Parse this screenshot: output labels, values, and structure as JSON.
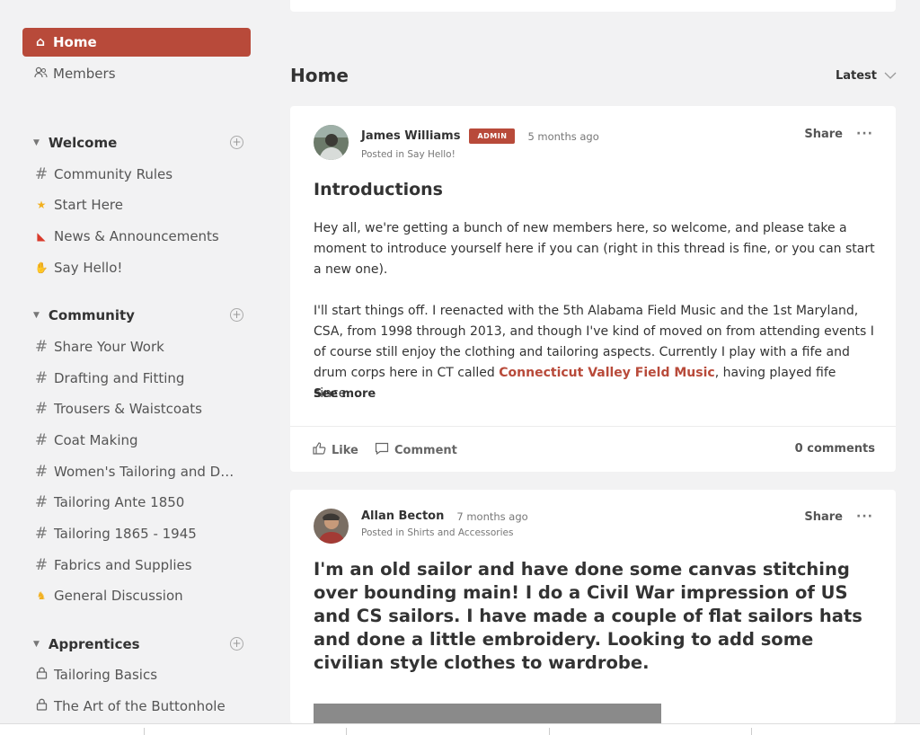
{
  "sidebar": {
    "nav": [
      {
        "label": "Home",
        "icon": "home-icon"
      },
      {
        "label": "Members",
        "icon": "members-icon"
      }
    ],
    "sections": [
      {
        "title": "Welcome",
        "channels": [
          {
            "label": "Community Rules",
            "icon": "hash-icon"
          },
          {
            "label": "Start Here",
            "icon": "star-icon"
          },
          {
            "label": "News & Announcements",
            "icon": "megaphone-icon"
          },
          {
            "label": "Say Hello!",
            "icon": "wave-icon"
          }
        ]
      },
      {
        "title": "Community",
        "channels": [
          {
            "label": "Share Your Work",
            "icon": "hash-icon"
          },
          {
            "label": "Drafting and Fitting",
            "icon": "hash-icon"
          },
          {
            "label": "Trousers & Waistcoats",
            "icon": "hash-icon"
          },
          {
            "label": "Coat Making",
            "icon": "hash-icon"
          },
          {
            "label": "Women's Tailoring and D…",
            "icon": "hash-icon"
          },
          {
            "label": "Tailoring Ante 1850",
            "icon": "hash-icon"
          },
          {
            "label": "Tailoring 1865 - 1945",
            "icon": "hash-icon"
          },
          {
            "label": "Fabrics and Supplies",
            "icon": "hash-icon"
          },
          {
            "label": "General Discussion",
            "icon": "cat-icon"
          }
        ]
      },
      {
        "title": "Apprentices",
        "channels": [
          {
            "label": "Tailoring Basics",
            "icon": "lock-icon"
          },
          {
            "label": "The Art of the Buttonhole",
            "icon": "lock-icon"
          }
        ]
      }
    ]
  },
  "main": {
    "title": "Home",
    "sort_label": "Latest",
    "posts": [
      {
        "author": "James Williams",
        "badge": "ADMIN",
        "time": "5 months ago",
        "posted_in": "Posted in Say Hello!",
        "share": "Share",
        "more": "···",
        "title": "Introductions",
        "para1": "Hey all, we're getting a bunch of new members here, so welcome, and please take a moment to introduce yourself here if you can (right in this thread is fine, or you can start a new one).",
        "para2_a": "I'll start things off. I reenacted with the 5th Alabama Field Music and the 1st Maryland, CSA, from 1998 through 2013, and though I've kind of moved on from attending events I of course still enjoy the clothing and tailoring aspects. Currently I play with a fife and drum corps here in CT called ",
        "para2_link": "Connecticut Valley Field Music",
        "para2_b": ", having played fife since…",
        "see_more": "See more",
        "like": "Like",
        "comment": "Comment",
        "comment_count": "0 comments"
      },
      {
        "author": "Allan Becton",
        "time": "7 months ago",
        "posted_in": "Posted in Shirts and Accessories",
        "share": "Share",
        "more": "···",
        "body": "I'm an old sailor and have done some canvas stitching over bounding main! I do a Civil War impression of US and CS sailors. I have made a couple of flat sailors hats and done a little embroidery. Looking to add some civilian style clothes to wardrobe."
      }
    ]
  },
  "colors": {
    "accent": "#b84a3a",
    "background": "#f2f2f3"
  }
}
